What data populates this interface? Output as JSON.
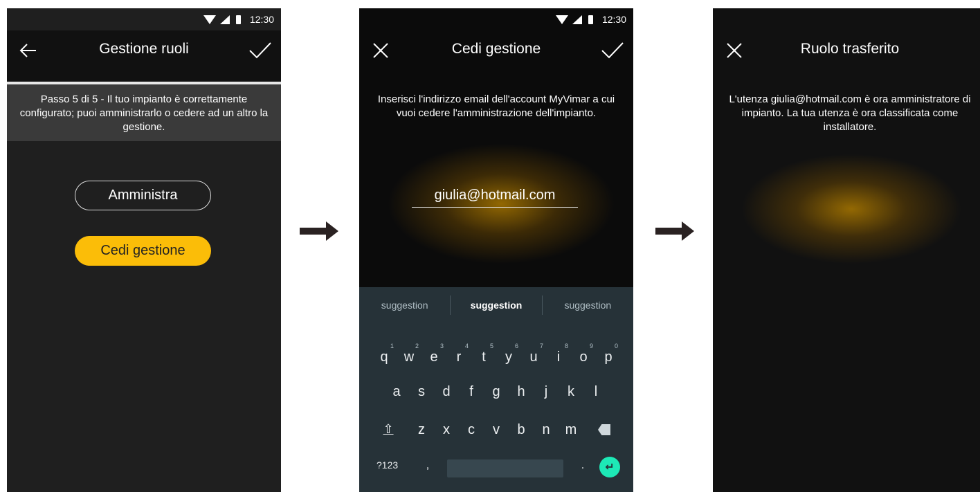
{
  "status_bar": {
    "time": "12:30"
  },
  "screen1": {
    "title": "Gestione ruoli",
    "back_icon": "arrow-left-icon",
    "confirm_icon": "checkmark-icon",
    "step_text": "Passo 5 di 5 - Il tuo impianto è correttamente configurato; puoi amministrarlo o cedere ad un altro la gestione.",
    "administer_button": "Amministra",
    "handover_button": "Cedi gestione",
    "accent_color": "#fbbd08"
  },
  "screen2": {
    "title": "Cedi gestione",
    "close_icon": "close-icon",
    "confirm_icon": "checkmark-icon",
    "instruction": "Inserisci l'indirizzo email dell'account MyVimar a cui vuoi cedere l'amministrazione dell'impianto.",
    "email_value": "giulia@hotmail.com",
    "suggestions": [
      "suggestion",
      "suggestion",
      "suggestion"
    ],
    "keyboard": {
      "row1": [
        "q",
        "w",
        "e",
        "r",
        "t",
        "y",
        "u",
        "i",
        "o",
        "p"
      ],
      "row1_hints": [
        "1",
        "2",
        "3",
        "4",
        "5",
        "6",
        "7",
        "8",
        "9",
        "0"
      ],
      "row2": [
        "a",
        "s",
        "d",
        "f",
        "g",
        "h",
        "j",
        "k",
        "l"
      ],
      "row3": [
        "z",
        "x",
        "c",
        "v",
        "b",
        "n",
        "m"
      ],
      "shift_label": "⇧",
      "num_label": "?123",
      "comma_label": ",",
      "period_label": ".",
      "enter_label": "↵"
    }
  },
  "screen3": {
    "title": "Ruolo trasferito",
    "close_icon": "close-icon",
    "message": "L'utenza giulia@hotmail.com è ora amministratore di impianto. La tua utenza è ora classificata come installatore."
  }
}
